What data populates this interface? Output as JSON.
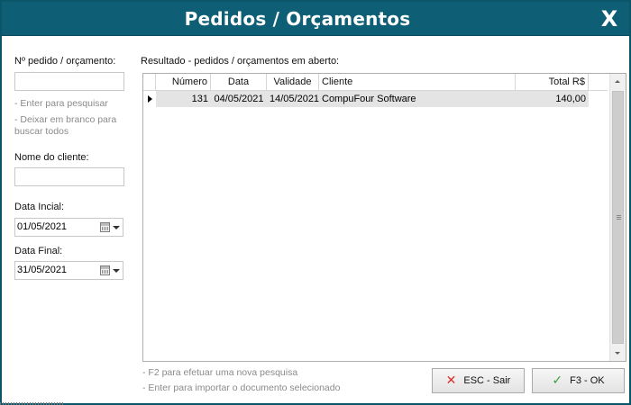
{
  "window": {
    "title": "Pedidos / Orçamentos",
    "close_glyph": "X",
    "accent_color": "#0e5f75"
  },
  "left_panel": {
    "order_label": "Nº pedido / orçamento:",
    "order_value": "",
    "hint_enter": "- Enter para pesquisar",
    "hint_blank": "- Deixar em branco para buscar todos",
    "client_label": "Nome do cliente:",
    "client_value": "",
    "start_date_label": "Data Incial:",
    "start_date_value": "01/05/2021",
    "end_date_label": "Data Final:",
    "end_date_value": "31/05/2021"
  },
  "results": {
    "label": "Resultado - pedidos / orçamentos em aberto:",
    "columns": [
      "Número",
      "Data",
      "Validade",
      "Cliente",
      "Total R$"
    ],
    "rows": [
      [
        "131",
        "04/05/2021",
        "14/05/2021",
        "CompuFour Software",
        "140,00"
      ]
    ]
  },
  "footer": {
    "hint_f2": "- F2 para efetuar uma nova pesquisa",
    "hint_enter": "- Enter para importar o documento selecionado",
    "esc_label": "ESC - Sair",
    "ok_label": "F3 - OK"
  }
}
